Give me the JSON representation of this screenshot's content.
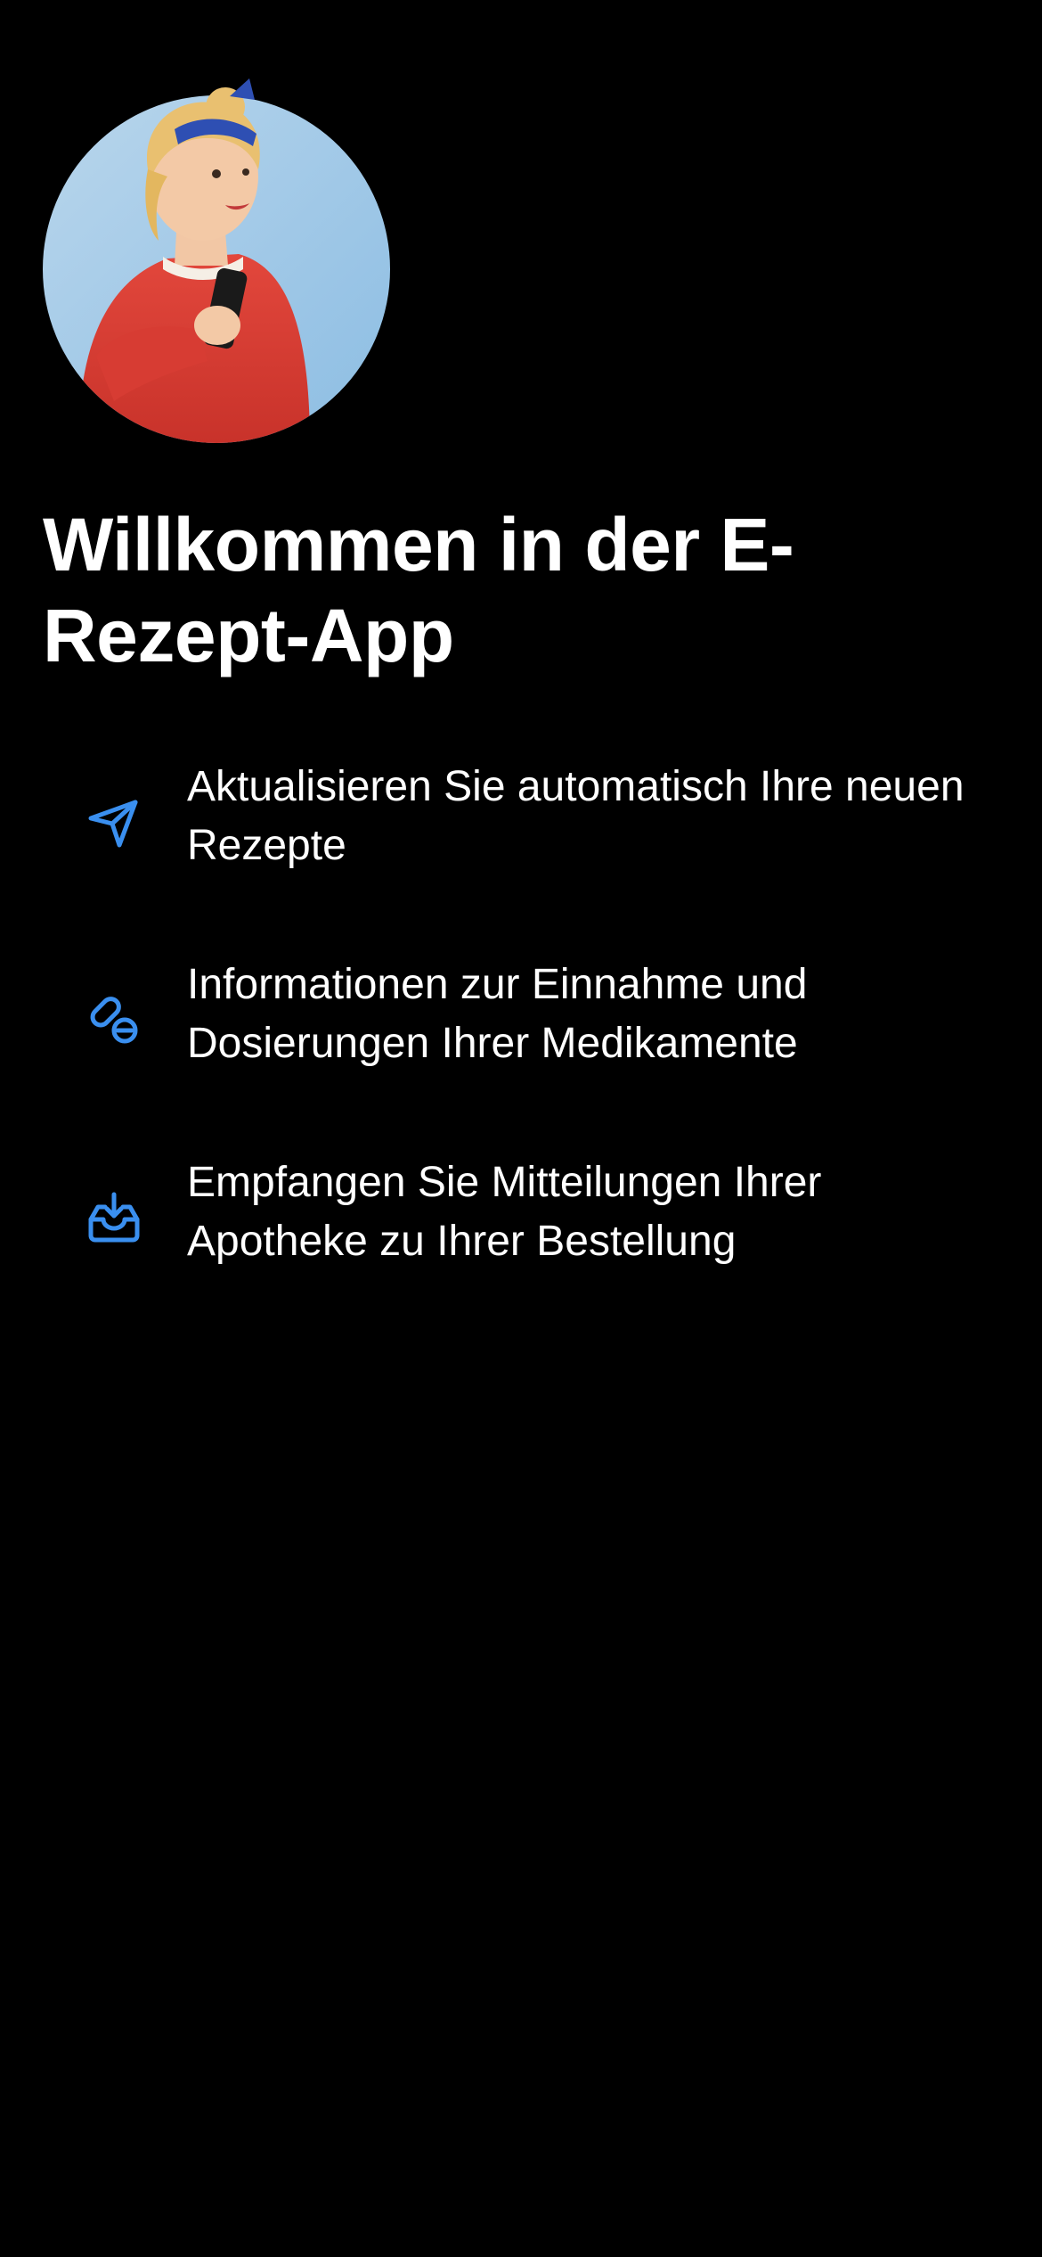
{
  "welcome": {
    "title": "Willkommen in der E-Rezept-App",
    "avatar_icon": "person-holding-phone-illustration"
  },
  "features": [
    {
      "icon": "paper-plane-icon",
      "text": "Aktualisieren Sie automatisch Ihre neuen Rezepte"
    },
    {
      "icon": "pills-icon",
      "text": "Informationen zur Einnahme und Dosierungen Ihrer Medikamente"
    },
    {
      "icon": "inbox-download-icon",
      "text": "Empfangen Sie Mitteilungen Ihrer Apotheke zu Ihrer Bestellung"
    }
  ],
  "colors": {
    "background": "#000000",
    "text": "#FFFFFF",
    "accent": "#3A8FEF"
  }
}
